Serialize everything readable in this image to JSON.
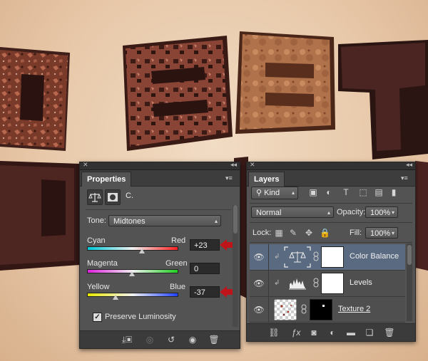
{
  "properties": {
    "tab": "Properties",
    "adjustment_title": "C.",
    "tone_label": "Tone:",
    "tone_value": "Midtones",
    "cyan_label": "Cyan",
    "red_label": "Red",
    "cyan_red_value": "+23",
    "magenta_label": "Magenta",
    "green_label": "Green",
    "magenta_green_value": "0",
    "yellow_label": "Yellow",
    "blue_label": "Blue",
    "yellow_blue_value": "-37",
    "preserve_luminosity_label": "Preserve Luminosity",
    "preserve_luminosity_checked": true,
    "sliders": {
      "cyan_red": 23,
      "magenta_green": 0,
      "yellow_blue": -37,
      "range": [
        -100,
        100
      ]
    },
    "accent_arrow_color": "#c0141b"
  },
  "layers": {
    "tab": "Layers",
    "filter_kind": "Kind",
    "blend_mode": "Normal",
    "opacity_label": "Opacity:",
    "opacity_value": "100%",
    "lock_label": "Lock:",
    "fill_label": "Fill:",
    "fill_value": "100%",
    "items": [
      {
        "name": "Color Balance",
        "selected": true,
        "thumb": "balance-scale-icon"
      },
      {
        "name": "Levels",
        "selected": false,
        "thumb": "histogram-icon"
      },
      {
        "name": "Texture 2",
        "selected": false,
        "thumb": "transparency-checker"
      }
    ]
  }
}
